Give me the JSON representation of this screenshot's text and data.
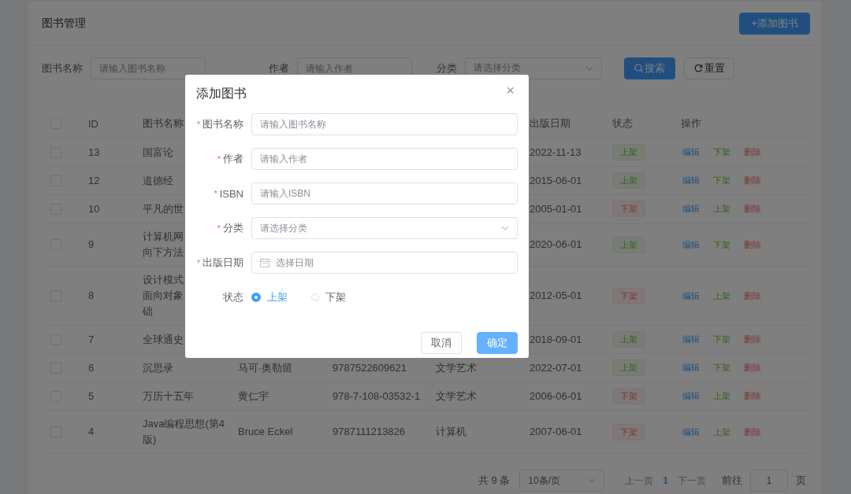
{
  "page": {
    "title": "图书管理",
    "add_button": "+添加图书"
  },
  "filters": [
    {
      "label": "图书名称",
      "kind": "input",
      "placeholder": "请输入图书名称"
    },
    {
      "label": "作者",
      "kind": "input",
      "placeholder": "请输入作者"
    },
    {
      "label": "分类",
      "kind": "select",
      "placeholder": "请选择分类"
    }
  ],
  "filter_buttons": [
    {
      "label": "搜索",
      "kind": "primary"
    },
    {
      "label": "重置",
      "kind": "default"
    }
  ],
  "table": {
    "header_checkbox": {
      "checked": false
    },
    "columns": [
      {
        "label": "ID"
      },
      {
        "label": "图书名称"
      },
      {},
      {},
      {},
      {
        "label": "出版日期"
      },
      {
        "label": "状态"
      },
      {
        "label": "操作"
      }
    ],
    "rows": [
      {
        "checked": false,
        "id": "13",
        "name_lines": [
          "国富论"
        ],
        "date": "2022-11-13",
        "status": {
          "text": "上架",
          "kind": "on"
        },
        "actions": [
          {
            "text": "编辑",
            "kind": "edit"
          },
          {
            "text": "下架",
            "kind": "toggle"
          },
          {
            "text": "删除",
            "kind": "delete"
          }
        ]
      },
      {
        "checked": false,
        "id": "12",
        "name_lines": [
          "道德经"
        ],
        "date": "2015-06-01",
        "status": {
          "text": "上架",
          "kind": "on"
        },
        "actions": [
          {
            "text": "编辑",
            "kind": "edit"
          },
          {
            "text": "下架",
            "kind": "toggle"
          },
          {
            "text": "删除",
            "kind": "delete"
          }
        ]
      },
      {
        "checked": false,
        "id": "10",
        "name_lines": [
          "平凡的世"
        ],
        "date": "2005-01-01",
        "status": {
          "text": "下架",
          "kind": "off"
        },
        "actions": [
          {
            "text": "编辑",
            "kind": "edit"
          },
          {
            "text": "上架",
            "kind": "toggle"
          },
          {
            "text": "删除",
            "kind": "delete"
          }
        ]
      },
      {
        "checked": false,
        "id": "9",
        "name_lines": [
          "计算机网",
          "向下方法"
        ],
        "date": "2020-06-01",
        "status": {
          "text": "上架",
          "kind": "on"
        },
        "actions": [
          {
            "text": "编辑",
            "kind": "edit"
          },
          {
            "text": "下架",
            "kind": "toggle"
          },
          {
            "text": "删除",
            "kind": "delete"
          }
        ]
      },
      {
        "checked": false,
        "id": "8",
        "name_lines": [
          "设计模式",
          "面向对象",
          "础"
        ],
        "date": "2012-05-01",
        "status": {
          "text": "下架",
          "kind": "off"
        },
        "actions": [
          {
            "text": "编辑",
            "kind": "edit"
          },
          {
            "text": "上架",
            "kind": "toggle"
          },
          {
            "text": "删除",
            "kind": "delete"
          }
        ]
      },
      {
        "checked": false,
        "id": "7",
        "name_lines": [
          "全球通史"
        ],
        "date": "2018-09-01",
        "status": {
          "text": "上架",
          "kind": "on"
        },
        "actions": [
          {
            "text": "编辑",
            "kind": "edit"
          },
          {
            "text": "下架",
            "kind": "toggle"
          },
          {
            "text": "删除",
            "kind": "delete"
          }
        ]
      },
      {
        "checked": false,
        "id": "6",
        "name_lines": [
          "沉思录"
        ],
        "author": "马可·奥勒留",
        "isbn": "9787522609621",
        "category": "文学艺术",
        "date": "2022-07-01",
        "status": {
          "text": "上架",
          "kind": "on"
        },
        "actions": [
          {
            "text": "编辑",
            "kind": "edit"
          },
          {
            "text": "下架",
            "kind": "toggle"
          },
          {
            "text": "删除",
            "kind": "delete"
          }
        ]
      },
      {
        "checked": false,
        "id": "5",
        "name_lines": [
          "万历十五年"
        ],
        "author": "黄仁宇",
        "isbn": "978-7-108-03532-1",
        "category": "文学艺术",
        "date": "2006-06-01",
        "status": {
          "text": "下架",
          "kind": "off"
        },
        "actions": [
          {
            "text": "编辑",
            "kind": "edit"
          },
          {
            "text": "上架",
            "kind": "toggle"
          },
          {
            "text": "删除",
            "kind": "delete"
          }
        ]
      },
      {
        "checked": false,
        "id": "4",
        "name_lines": [
          "Java编程思想(第4",
          "版)"
        ],
        "author": "Bruce Eckel",
        "isbn": "9787111213826",
        "category": "计算机",
        "date": "2007-06-01",
        "status": {
          "text": "下架",
          "kind": "off"
        },
        "actions": [
          {
            "text": "编辑",
            "kind": "edit"
          },
          {
            "text": "上架",
            "kind": "toggle"
          },
          {
            "text": "删除",
            "kind": "delete"
          }
        ]
      }
    ]
  },
  "pagination": {
    "total": "共 9 条",
    "page_size": "10条/页",
    "prev": {
      "text": "上一页",
      "disabled": true
    },
    "pages": [
      {
        "text": "1",
        "selected": true
      }
    ],
    "next": {
      "text": "下一页",
      "disabled": true
    },
    "goto_label": "前往",
    "goto_value": "1",
    "goto_suffix": "页"
  },
  "dialog": {
    "title": "添加图书",
    "close": "×",
    "required_mark": "*",
    "fields": [
      {
        "label": "图书名称",
        "required": true,
        "kind": "input",
        "placeholder": "请输入图书名称"
      },
      {
        "label": "作者",
        "required": true,
        "kind": "input",
        "placeholder": "请输入作者"
      },
      {
        "label": "ISBN",
        "required": true,
        "kind": "input",
        "placeholder": "请输入ISBN"
      },
      {
        "label": "分类",
        "required": true,
        "kind": "select",
        "placeholder": "请选择分类"
      },
      {
        "label": "出版日期",
        "required": true,
        "kind": "date",
        "placeholder": "选择日期"
      },
      {
        "label": "状态",
        "required": false,
        "kind": "radio",
        "options": [
          {
            "label": "上架",
            "selected": true
          },
          {
            "label": "下架",
            "selected": false
          }
        ]
      }
    ],
    "buttons": [
      {
        "label": "取消",
        "kind": "default"
      },
      {
        "label": "确定",
        "kind": "primary"
      }
    ]
  }
}
